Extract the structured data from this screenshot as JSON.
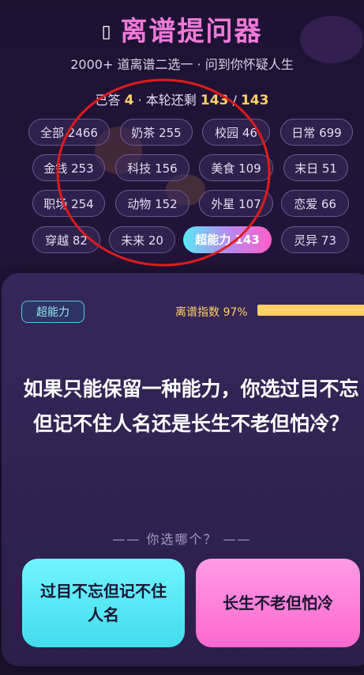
{
  "header": {
    "title_glyph": "▯",
    "title": "离谱提问器",
    "subtitle": "2000+ 道离谱二选一 · 问到你怀疑人生",
    "stats": {
      "answered_label": "已答",
      "answered": "4",
      "remaining_label": "· 本轮还剩",
      "remaining": "143",
      "sep": "/",
      "total": "143"
    }
  },
  "categories": [
    {
      "label": "全部 2466"
    },
    {
      "label": "奶茶 255"
    },
    {
      "label": "校园 46"
    },
    {
      "label": "日常 699"
    },
    {
      "label": "金钱 253"
    },
    {
      "label": "科技 156"
    },
    {
      "label": "美食 109"
    },
    {
      "label": "末日 51"
    },
    {
      "label": "职场 254"
    },
    {
      "label": "动物 152"
    },
    {
      "label": "外星 107"
    },
    {
      "label": "恋爱 66"
    },
    {
      "label": "穿越 82"
    },
    {
      "label": "未来 20"
    },
    {
      "label": "超能力 143"
    },
    {
      "label": "灵异 73"
    }
  ],
  "active_category": "超能力 143",
  "card": {
    "tag": "超能力",
    "absurdity_label": "离谱指数 97%",
    "absurdity_value": 0.97,
    "question": "如果只能保留一种能力，你选过目不忘但记不住人名还是长生不老但怕冷？",
    "prompt": "—— 你选哪个？ ——",
    "option_a": "过目不忘但记不住人名",
    "option_b": "长生不老但怕冷"
  },
  "colors": {
    "accent_pink": "#f07ad8",
    "accent_yellow": "#ffd166",
    "option_a": "#43dcec",
    "option_b": "#ff68cf",
    "annotation": "#e01b1b"
  }
}
